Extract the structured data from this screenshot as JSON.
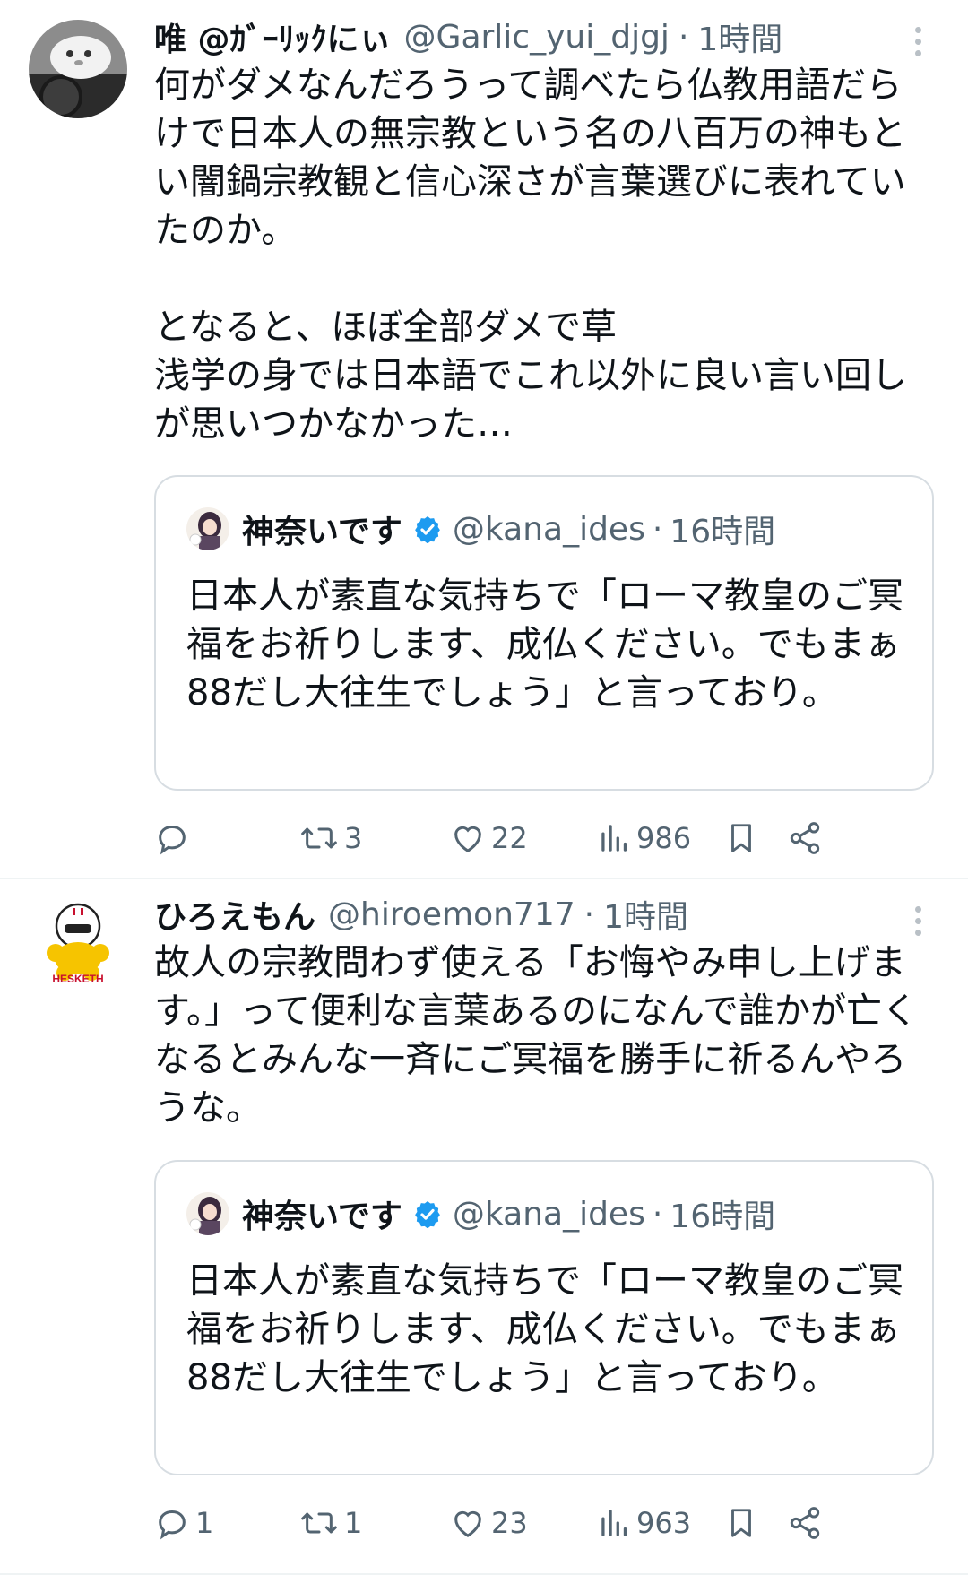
{
  "tweets": [
    {
      "name": "唯 @ｶﾞｰﾘｯｸにぃ",
      "handle": "@Garlic_yui_djgj",
      "time": "1時間",
      "text": "何がダメなんだろうって調べたら仏教用語だらけで日本人の無宗教という名の八百万の神もとい闇鍋宗教観と信心深さが言葉選びに表れていたのか。\n\nとなると、ほぼ全部ダメで草\n浅学の身では日本語でこれ以外に良い言い回しが思いつかなかった…",
      "quote": {
        "name": "神奈いです",
        "handle": "@kana_ides",
        "time": "16時間",
        "text": "日本人が素直な気持ちで「ローマ教皇のご冥福をお祈りします、成仏ください。でもまぁ88だし大往生でしょう」と言っており。"
      },
      "actions": {
        "replies": "",
        "retweets": "3",
        "likes": "22",
        "views": "986"
      }
    },
    {
      "name": "ひろえもん",
      "handle": "@hiroemon717",
      "time": "1時間",
      "avatar_text": "HESKETH",
      "text": "故人の宗教問わず使える「お悔やみ申し上げます。」って便利な言葉あるのになんで誰かが亡くなるとみんな一斉にご冥福を勝手に祈るんやろうな。",
      "quote": {
        "name": "神奈いです",
        "handle": "@kana_ides",
        "time": "16時間",
        "text": "日本人が素直な気持ちで「ローマ教皇のご冥福をお祈りします、成仏ください。でもまぁ88だし大往生でしょう」と言っており。"
      },
      "actions": {
        "replies": "1",
        "retweets": "1",
        "likes": "23",
        "views": "963"
      }
    }
  ],
  "separator": "·",
  "colors": {
    "text": "#0f1419",
    "muted": "#536471",
    "verified": "#1d9bf0",
    "border": "#d7dde2"
  },
  "icons": [
    "reply-icon",
    "retweet-icon",
    "like-icon",
    "views-icon",
    "bookmark-icon",
    "share-icon",
    "more-icon",
    "verified-icon"
  ]
}
